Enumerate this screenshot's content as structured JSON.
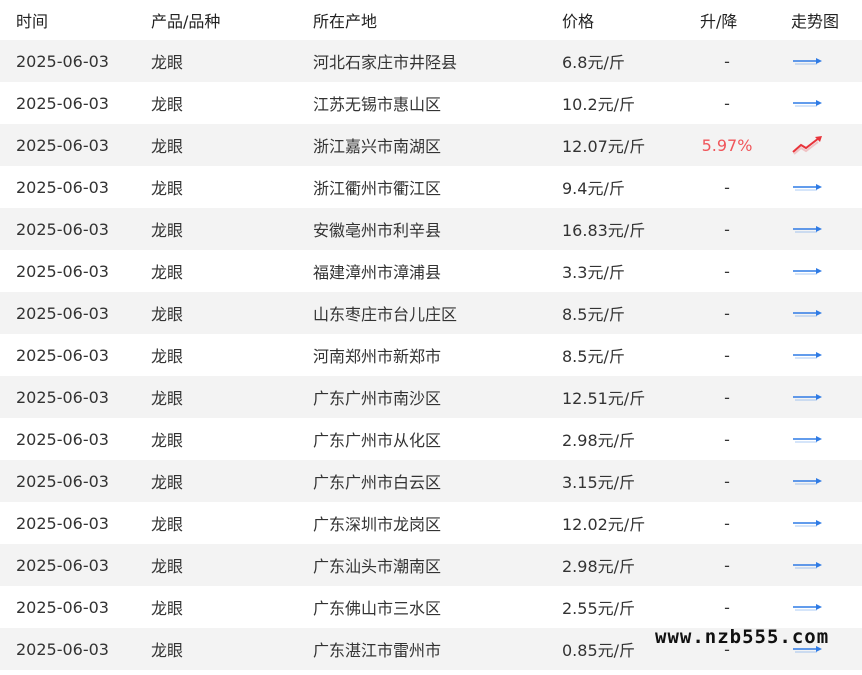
{
  "header": {
    "date": "时间",
    "product": "产品/品种",
    "location": "所在产地",
    "price": "价格",
    "change": "升/降",
    "trend": "走势图"
  },
  "rows": [
    {
      "date": "2025-06-03",
      "product": "龙眼",
      "location": "河北石家庄市井陉县",
      "price": "6.8元/斤",
      "change": "-",
      "trend_icon": "flat-arrow-icon"
    },
    {
      "date": "2025-06-03",
      "product": "龙眼",
      "location": "江苏无锡市惠山区",
      "price": "10.2元/斤",
      "change": "-",
      "trend_icon": "flat-arrow-icon"
    },
    {
      "date": "2025-06-03",
      "product": "龙眼",
      "location": "浙江嘉兴市南湖区",
      "price": "12.07元/斤",
      "change": "5.97%",
      "trend_icon": "up-arrow-icon"
    },
    {
      "date": "2025-06-03",
      "product": "龙眼",
      "location": "浙江衢州市衢江区",
      "price": "9.4元/斤",
      "change": "-",
      "trend_icon": "flat-arrow-icon"
    },
    {
      "date": "2025-06-03",
      "product": "龙眼",
      "location": "安徽亳州市利辛县",
      "price": "16.83元/斤",
      "change": "-",
      "trend_icon": "flat-arrow-icon"
    },
    {
      "date": "2025-06-03",
      "product": "龙眼",
      "location": "福建漳州市漳浦县",
      "price": "3.3元/斤",
      "change": "-",
      "trend_icon": "flat-arrow-icon"
    },
    {
      "date": "2025-06-03",
      "product": "龙眼",
      "location": "山东枣庄市台儿庄区",
      "price": "8.5元/斤",
      "change": "-",
      "trend_icon": "flat-arrow-icon"
    },
    {
      "date": "2025-06-03",
      "product": "龙眼",
      "location": "河南郑州市新郑市",
      "price": "8.5元/斤",
      "change": "-",
      "trend_icon": "flat-arrow-icon"
    },
    {
      "date": "2025-06-03",
      "product": "龙眼",
      "location": "广东广州市南沙区",
      "price": "12.51元/斤",
      "change": "-",
      "trend_icon": "flat-arrow-icon"
    },
    {
      "date": "2025-06-03",
      "product": "龙眼",
      "location": "广东广州市从化区",
      "price": "2.98元/斤",
      "change": "-",
      "trend_icon": "flat-arrow-icon"
    },
    {
      "date": "2025-06-03",
      "product": "龙眼",
      "location": "广东广州市白云区",
      "price": "3.15元/斤",
      "change": "-",
      "trend_icon": "flat-arrow-icon"
    },
    {
      "date": "2025-06-03",
      "product": "龙眼",
      "location": "广东深圳市龙岗区",
      "price": "12.02元/斤",
      "change": "-",
      "trend_icon": "flat-arrow-icon"
    },
    {
      "date": "2025-06-03",
      "product": "龙眼",
      "location": "广东汕头市潮南区",
      "price": "2.98元/斤",
      "change": "-",
      "trend_icon": "flat-arrow-icon"
    },
    {
      "date": "2025-06-03",
      "product": "龙眼",
      "location": "广东佛山市三水区",
      "price": "2.55元/斤",
      "change": "-",
      "trend_icon": "flat-arrow-icon"
    },
    {
      "date": "2025-06-03",
      "product": "龙眼",
      "location": "广东湛江市雷州市",
      "price": "0.85元/斤",
      "change": "-",
      "trend_icon": "flat-arrow-icon"
    }
  ],
  "colors": {
    "rise": "#f0555a",
    "flat_arrow": "#2f7be5",
    "up_arrow": "#e8333a",
    "row_alt": "#f3f3f3"
  },
  "watermark": "www.nzb555.com"
}
